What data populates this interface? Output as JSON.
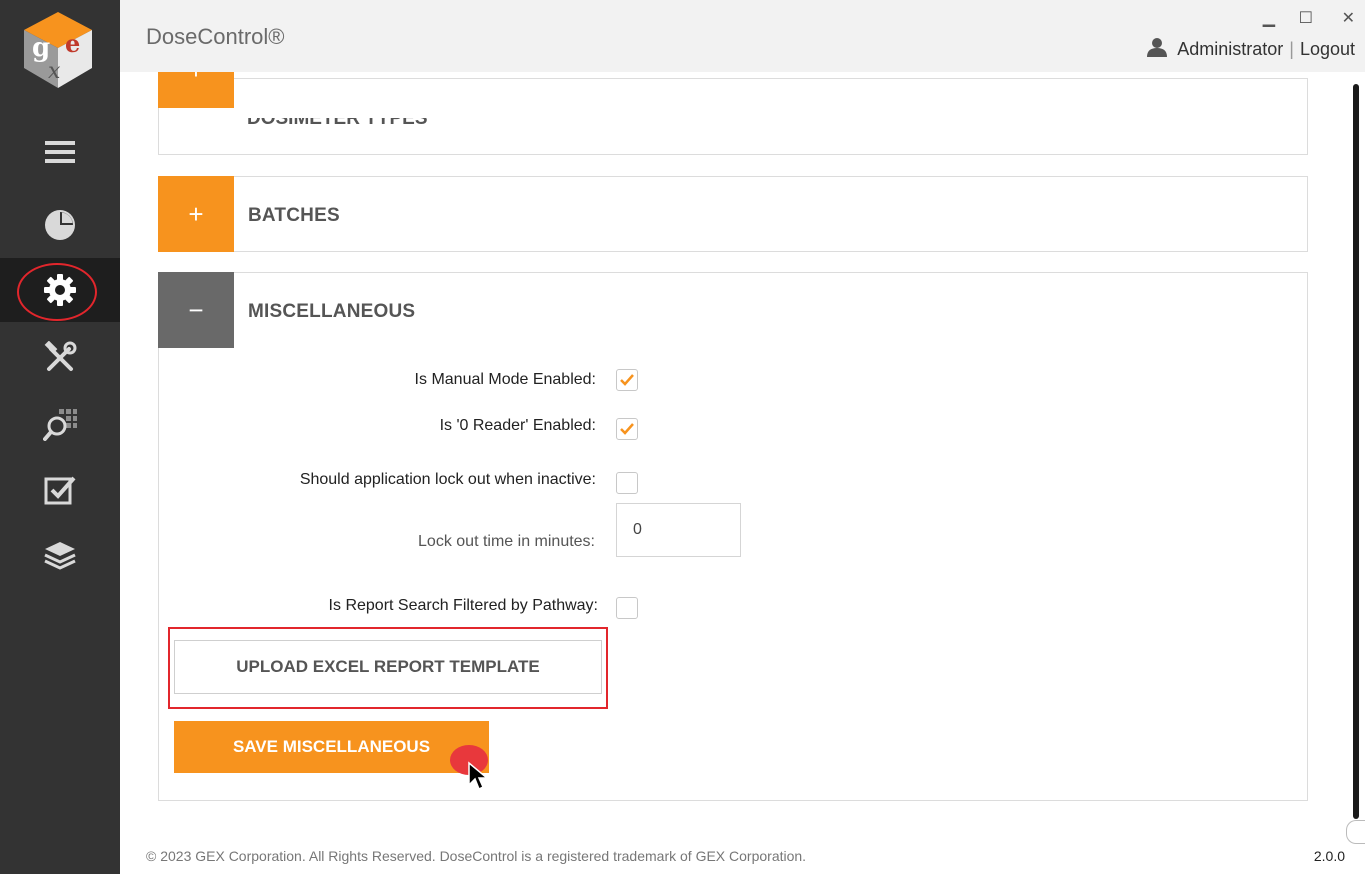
{
  "app": {
    "title": "DoseControl®",
    "version": "2.0.0",
    "footer": "© 2023 GEX Corporation. All Rights Reserved. DoseControl is a registered trademark of GEX Corporation."
  },
  "window": {
    "minimize": "▁",
    "maximize": "☐",
    "close": "✕"
  },
  "user": {
    "name": "Administrator",
    "separator": "|",
    "logout": "Logout"
  },
  "sidebar": {
    "items": [
      {
        "icon": "menu-icon"
      },
      {
        "icon": "dashboard-pie-icon"
      },
      {
        "icon": "settings-gear-icon",
        "active": true
      },
      {
        "icon": "tools-icon"
      },
      {
        "icon": "search-grid-icon"
      },
      {
        "icon": "checklist-icon"
      },
      {
        "icon": "layers-icon"
      }
    ]
  },
  "sections": {
    "dosimeter_types": {
      "title": "DOSIMETER TYPES",
      "toggle": "+"
    },
    "batches": {
      "title": "BATCHES",
      "toggle": "+"
    },
    "miscellaneous": {
      "title": "MISCELLANEOUS",
      "toggle": "−"
    }
  },
  "misc": {
    "manual_mode_label": "Is Manual Mode Enabled:",
    "manual_mode_checked": true,
    "zero_reader_label": "Is '0 Reader' Enabled:",
    "zero_reader_checked": true,
    "lockout_label": "Should application lock out when inactive:",
    "lockout_checked": false,
    "lockout_time_label": "Lock out time in minutes:",
    "lockout_time_value": "0",
    "report_filter_label": "Is Report Search Filtered by Pathway:",
    "report_filter_checked": false,
    "upload_button": "UPLOAD EXCEL REPORT TEMPLATE",
    "save_button": "SAVE MISCELLANEOUS"
  },
  "colors": {
    "accent": "#f7931e",
    "sidebar": "#333333",
    "highlight": "#e2262c"
  }
}
